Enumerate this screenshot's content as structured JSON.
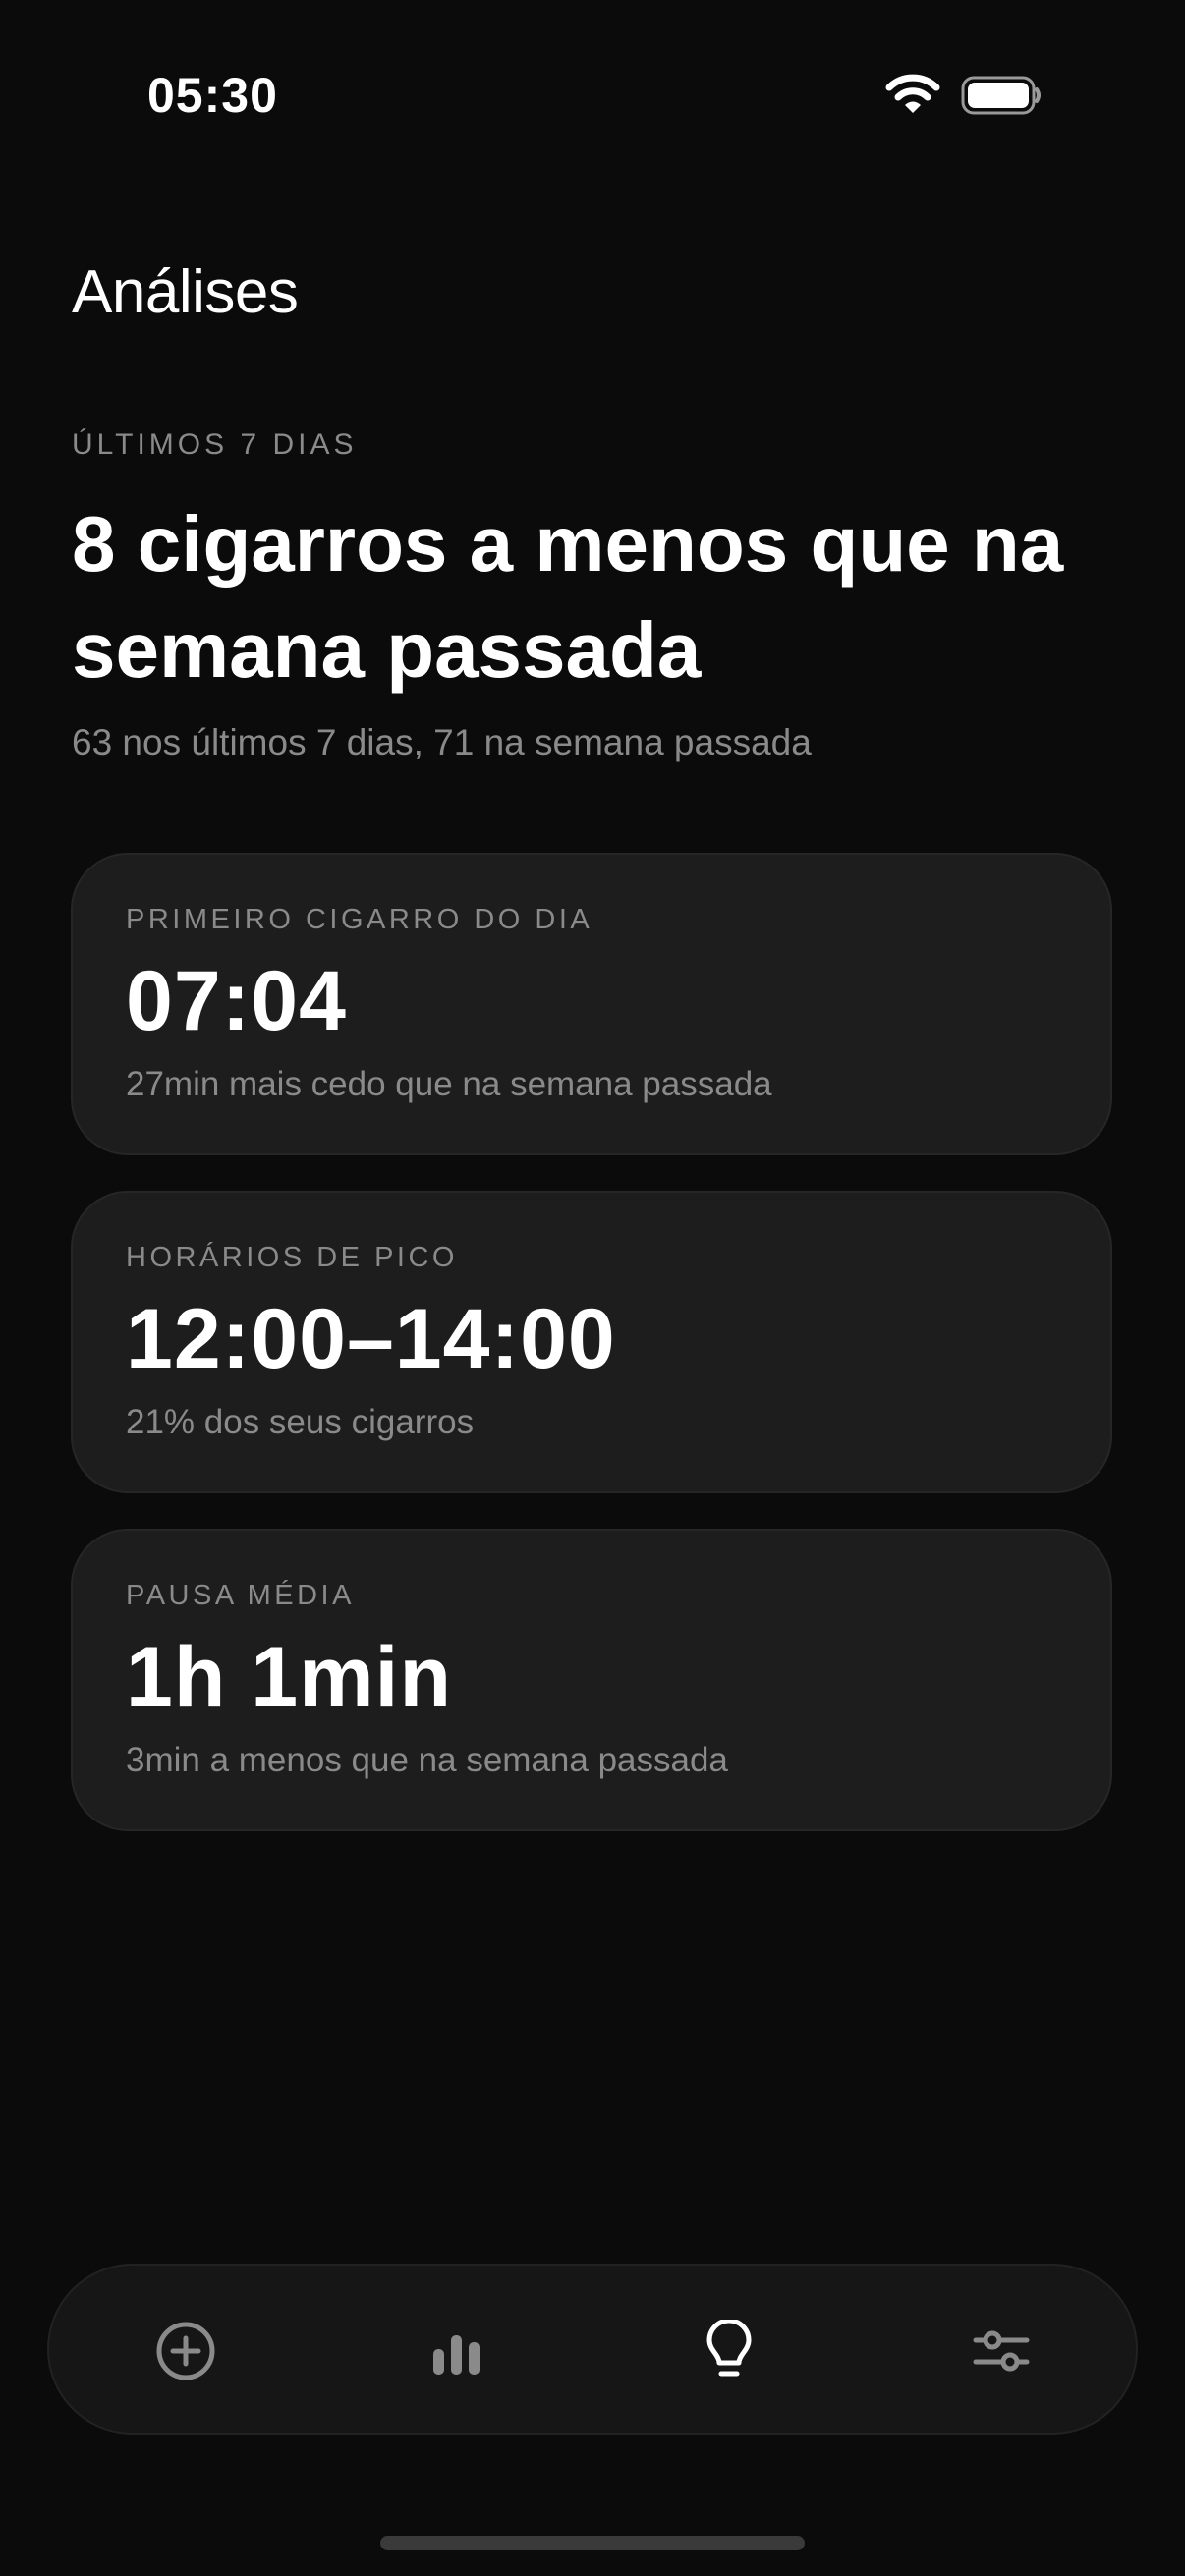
{
  "status_bar": {
    "time": "05:30",
    "icons": [
      "wifi-icon",
      "battery-icon"
    ]
  },
  "header": {
    "title": "Análises"
  },
  "summary": {
    "period_label": "ÚLTIMOS 7 DIAS",
    "headline": "8 cigarros a menos que na semana passada",
    "detail": "63 nos últimos 7 dias, 71 na semana passada"
  },
  "cards": [
    {
      "label": "PRIMEIRO CIGARRO DO DIA",
      "value": "07:04",
      "note": "27min mais cedo que na semana passada"
    },
    {
      "label": "HORÁRIOS DE PICO",
      "value": "12:00–14:00",
      "note": "21% dos seus cigarros"
    },
    {
      "label": "PAUSA MÉDIA",
      "value": "1h 1min",
      "note": "3min a menos que na semana passada"
    }
  ],
  "tab_bar": {
    "tabs": [
      {
        "icon": "plus-circle-icon",
        "active": false
      },
      {
        "icon": "bar-chart-icon",
        "active": false
      },
      {
        "icon": "lightbulb-icon",
        "active": true
      },
      {
        "icon": "sliders-icon",
        "active": false
      }
    ]
  },
  "colors": {
    "background": "#0b0b0b",
    "card": "#1d1d1d",
    "text_primary": "#ffffff",
    "text_secondary": "#8a8a8a",
    "tab_active": "#ffffff",
    "tab_inactive": "#8a8a8a"
  }
}
